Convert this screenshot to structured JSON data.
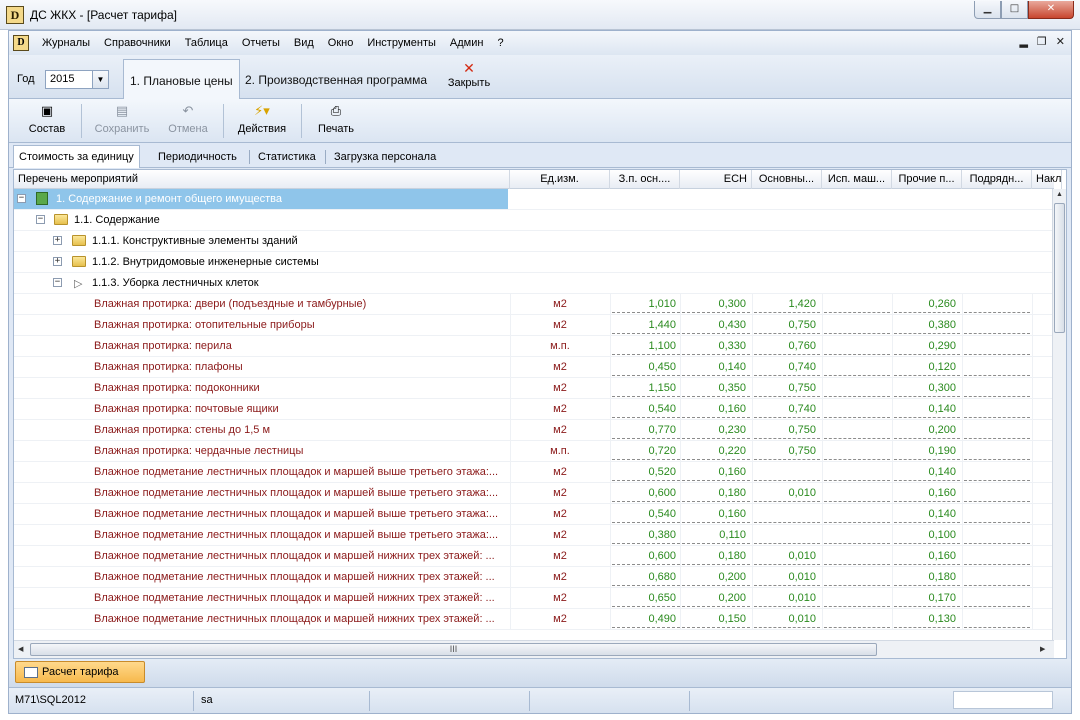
{
  "window": {
    "title": "ДС ЖКХ - [Расчет тарифа]",
    "logo": "D",
    "controls": [
      "minimize",
      "maximize",
      "close"
    ]
  },
  "menu": {
    "items": [
      "Журналы",
      "Справочники",
      "Таблица",
      "Отчеты",
      "Вид",
      "Окно",
      "Инструменты",
      "Админ",
      "?"
    ],
    "mdi_controls": [
      "minimize",
      "restore",
      "close"
    ]
  },
  "ribbon": {
    "year_label": "Год",
    "year_value": "2015",
    "tabs": [
      "1. Плановые цены",
      "2. Производственная программа"
    ],
    "active_tab": 0,
    "close_label": "Закрыть"
  },
  "toolbar": {
    "buttons": [
      {
        "label": "Состав",
        "icon": "dropdown-box-icon",
        "enabled": true
      },
      {
        "label": "Сохранить",
        "icon": "save-icon",
        "enabled": false
      },
      {
        "label": "Отмена",
        "icon": "undo-icon",
        "enabled": false
      },
      {
        "label": "Действия",
        "icon": "lightning-icon",
        "enabled": true
      },
      {
        "label": "Печать",
        "icon": "printer-icon",
        "enabled": true
      }
    ]
  },
  "subtabs": {
    "items": [
      "Стоимость за единицу",
      "Периодичность",
      "Статистика",
      "Загрузка персонала"
    ],
    "active": 0
  },
  "grid": {
    "columns": [
      "Перечень мероприятий",
      "Ед.изм.",
      "З.п. осн....",
      "ЕСН",
      "Основны...",
      "Исп. маш...",
      "Прочие п...",
      "Подрядн...",
      "Накла"
    ],
    "groups": [
      {
        "level": 0,
        "label": "1. Содержание и ремонт общего имущества",
        "toggle": "−",
        "icon": "book",
        "selected": true
      },
      {
        "level": 1,
        "label": "1.1. Содержание",
        "toggle": "−",
        "icon": "folder"
      },
      {
        "level": 2,
        "label": "1.1.1. Конструктивные элементы зданий",
        "toggle": "+",
        "icon": "folder"
      },
      {
        "level": 2,
        "label": "1.1.2. Внутридомовые инженерные системы",
        "toggle": "+",
        "icon": "folder"
      },
      {
        "level": 2,
        "label": "1.1.3. Уборка лестничных клеток",
        "toggle": "−",
        "icon": "arrow"
      }
    ],
    "rows": [
      {
        "name": "Влажная протирка: двери (подъездные и тамбурные)",
        "unit": "м2",
        "zp": "1,010",
        "esn": "0,300",
        "osn": "1,420",
        "isp": "",
        "proch": "0,260",
        "podr": ""
      },
      {
        "name": "Влажная протирка: отопительные приборы",
        "unit": "м2",
        "zp": "1,440",
        "esn": "0,430",
        "osn": "0,750",
        "isp": "",
        "proch": "0,380",
        "podr": ""
      },
      {
        "name": "Влажная протирка: перила",
        "unit": "м.п.",
        "zp": "1,100",
        "esn": "0,330",
        "osn": "0,760",
        "isp": "",
        "proch": "0,290",
        "podr": ""
      },
      {
        "name": "Влажная протирка: плафоны",
        "unit": "м2",
        "zp": "0,450",
        "esn": "0,140",
        "osn": "0,740",
        "isp": "",
        "proch": "0,120",
        "podr": ""
      },
      {
        "name": "Влажная протирка: подоконники",
        "unit": "м2",
        "zp": "1,150",
        "esn": "0,350",
        "osn": "0,750",
        "isp": "",
        "proch": "0,300",
        "podr": ""
      },
      {
        "name": "Влажная протирка: почтовые ящики",
        "unit": "м2",
        "zp": "0,540",
        "esn": "0,160",
        "osn": "0,740",
        "isp": "",
        "proch": "0,140",
        "podr": ""
      },
      {
        "name": "Влажная протирка: стены до 1,5 м",
        "unit": "м2",
        "zp": "0,770",
        "esn": "0,230",
        "osn": "0,750",
        "isp": "",
        "proch": "0,200",
        "podr": ""
      },
      {
        "name": "Влажная протирка: чердачные лестницы",
        "unit": "м.п.",
        "zp": "0,720",
        "esn": "0,220",
        "osn": "0,750",
        "isp": "",
        "proch": "0,190",
        "podr": ""
      },
      {
        "name": "Влажное подметание  лестничных площадок и маршей выше третьего этажа:...",
        "unit": "м2",
        "zp": "0,520",
        "esn": "0,160",
        "osn": "",
        "isp": "",
        "proch": "0,140",
        "podr": ""
      },
      {
        "name": "Влажное подметание  лестничных площадок и маршей выше третьего этажа:...",
        "unit": "м2",
        "zp": "0,600",
        "esn": "0,180",
        "osn": "0,010",
        "isp": "",
        "proch": "0,160",
        "podr": ""
      },
      {
        "name": "Влажное подметание  лестничных площадок и маршей выше третьего этажа:...",
        "unit": "м2",
        "zp": "0,540",
        "esn": "0,160",
        "osn": "",
        "isp": "",
        "proch": "0,140",
        "podr": ""
      },
      {
        "name": "Влажное подметание  лестничных площадок и маршей выше третьего этажа:...",
        "unit": "м2",
        "zp": "0,380",
        "esn": "0,110",
        "osn": "",
        "isp": "",
        "proch": "0,100",
        "podr": ""
      },
      {
        "name": "Влажное подметание  лестничных площадок и маршей нижних трех этажей: ...",
        "unit": "м2",
        "zp": "0,600",
        "esn": "0,180",
        "osn": "0,010",
        "isp": "",
        "proch": "0,160",
        "podr": ""
      },
      {
        "name": "Влажное подметание  лестничных площадок и маршей нижних трех этажей: ...",
        "unit": "м2",
        "zp": "0,680",
        "esn": "0,200",
        "osn": "0,010",
        "isp": "",
        "proch": "0,180",
        "podr": ""
      },
      {
        "name": "Влажное подметание  лестничных площадок и маршей нижних трех этажей: ...",
        "unit": "м2",
        "zp": "0,650",
        "esn": "0,200",
        "osn": "0,010",
        "isp": "",
        "proch": "0,170",
        "podr": ""
      },
      {
        "name": "Влажное подметание  лестничных площадок и маршей нижних трех этажей: ...",
        "unit": "м2",
        "zp": "0,490",
        "esn": "0,150",
        "osn": "0,010",
        "isp": "",
        "proch": "0,130",
        "podr": ""
      }
    ],
    "hscroll_grip": "III"
  },
  "taskbar": {
    "items": [
      "Расчет тарифа"
    ]
  },
  "status": {
    "server": "M71\\SQL2012",
    "user": "sa",
    "extra": ""
  },
  "colors": {
    "accent": "#8fc5ea",
    "name_text": "#8b1a1a",
    "number_text": "#2a8a1e",
    "frame": "#dfe8f5"
  }
}
